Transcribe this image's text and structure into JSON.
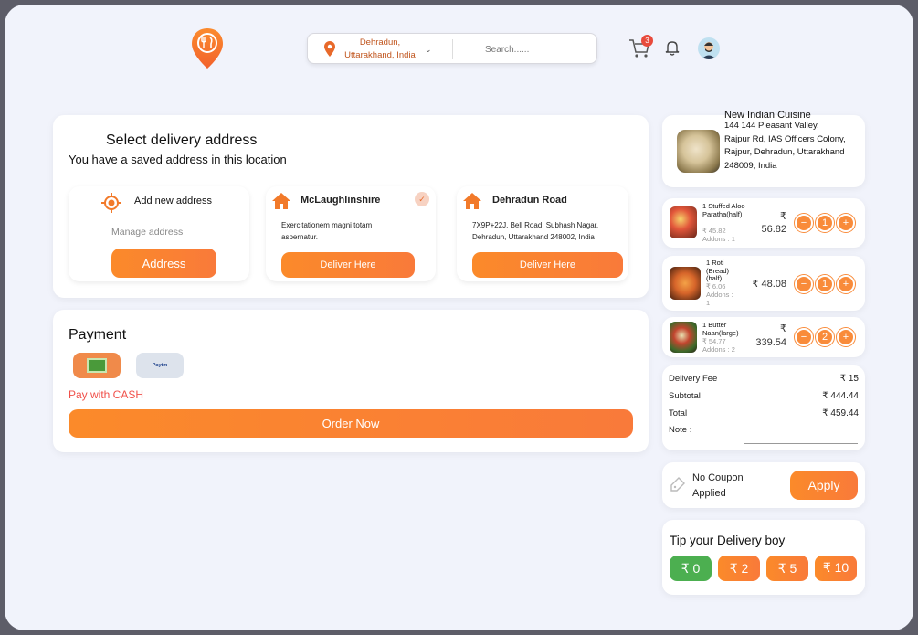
{
  "header": {
    "location": "Dehradun, Uttarakhand, India",
    "search_placeholder": "Search......",
    "cart_count": "3"
  },
  "address_section": {
    "title": "Select delivery address",
    "subtitle": "You have a saved address in this location",
    "new_address": {
      "title": "Add new address",
      "text": "Manage address",
      "button": "Address"
    },
    "cards": [
      {
        "title": "McLaughlinshire",
        "text": "Exercitationem magni totam aspernatur.",
        "button": "Deliver Here"
      },
      {
        "title": "Dehradun Road",
        "text": "7X9P+22J, Bell Road, Subhash Nagar, Dehradun, Uttarakhand 248002, India",
        "button": "Deliver Here"
      }
    ]
  },
  "payment": {
    "title": "Payment",
    "selected_method": "Pay with CASH",
    "paytm_label": "Paytm",
    "order_button": "Order Now"
  },
  "restaurant": {
    "name": "New Indian Cuisine",
    "address": "144 144 Pleasant Valley, Rajpur Rd, IAS Officers Colony, Rajpur, Dehradun, Uttarakhand 248009, India"
  },
  "cart_items": [
    {
      "name": "1 Stuffed Aloo Paratha(half)",
      "unit_price": "₹ 45.82",
      "addons": "Addons : 1",
      "total": "₹ 56.82",
      "qty": "1"
    },
    {
      "name": "1 Roti (Bread) (half)",
      "unit_price": "₹ 6.06",
      "addons": "Addons : 1",
      "total": "₹ 48.08",
      "qty": "1"
    },
    {
      "name": "1 Butter Naan(large)",
      "unit_price": "₹ 54.77",
      "addons": "Addons : 2",
      "total": "₹ 339.54",
      "qty": "2"
    }
  ],
  "bill": {
    "delivery_fee_label": "Delivery Fee",
    "delivery_fee": "₹ 15",
    "subtotal_label": "Subtotal",
    "subtotal": "₹ 444.44",
    "total_label": "Total",
    "total": "₹ 459.44",
    "note_label": "Note :"
  },
  "coupon": {
    "text": "No Coupon Applied",
    "button": "Apply"
  },
  "tip": {
    "title": "Tip your Delivery boy",
    "options": [
      "₹ 0",
      "₹ 2",
      "₹ 5",
      "₹ 10"
    ]
  },
  "colors": {
    "accent": "#f98b3a",
    "green": "#4caf50",
    "red_text": "#f0504a",
    "background": "#f1f3fb"
  }
}
